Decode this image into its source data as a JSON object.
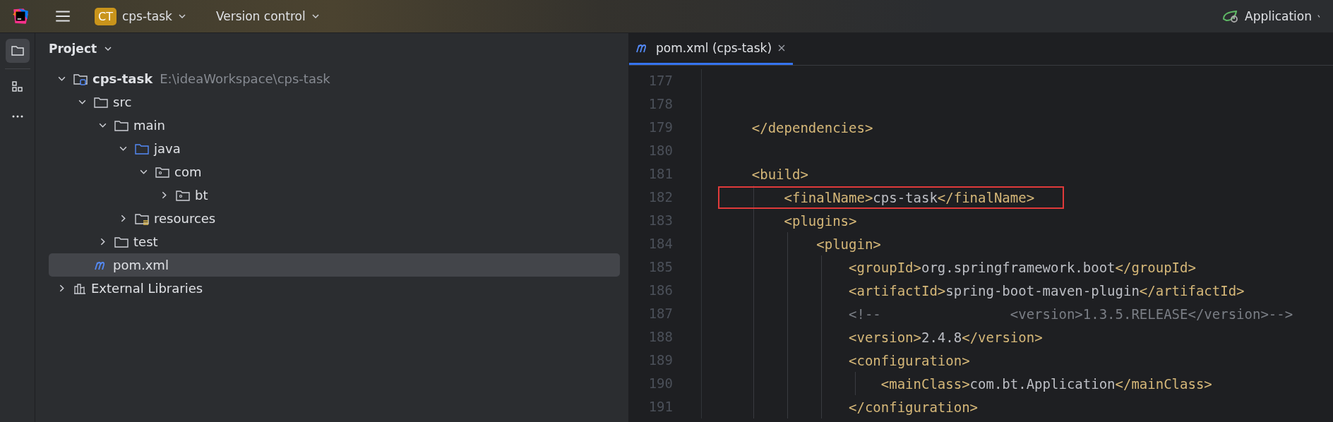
{
  "toolbar": {
    "project_badge": "CT",
    "project": "cps-task",
    "vcs": "Version control",
    "run_config": "Application"
  },
  "tool_stripe": [
    {
      "kind": "project",
      "selected": true
    },
    {
      "kind": "structure",
      "selected": false
    },
    {
      "kind": "more",
      "selected": false
    }
  ],
  "project_panel": {
    "title": "Project",
    "tree": [
      {
        "label": "cps-task",
        "hint": "E:\\ideaWorkspace\\cps-task",
        "kind": "module",
        "expanded": true,
        "selected": false,
        "children": [
          {
            "label": "src",
            "kind": "folder",
            "expanded": true,
            "selected": false,
            "children": [
              {
                "label": "main",
                "kind": "folder",
                "expanded": true,
                "selected": false,
                "children": [
                  {
                    "label": "java",
                    "kind": "source",
                    "expanded": true,
                    "selected": false,
                    "children": [
                      {
                        "label": "com",
                        "kind": "package",
                        "expanded": true,
                        "selected": false,
                        "children": [
                          {
                            "label": "bt",
                            "kind": "package",
                            "expanded": false,
                            "selected": false
                          }
                        ]
                      }
                    ]
                  },
                  {
                    "label": "resources",
                    "kind": "resources",
                    "expanded": false,
                    "selected": false
                  }
                ]
              },
              {
                "label": "test",
                "kind": "folder",
                "expanded": false,
                "selected": false
              }
            ]
          },
          {
            "label": "pom.xml",
            "kind": "maven",
            "selected": true
          }
        ]
      },
      {
        "label": "External Libraries",
        "kind": "library",
        "expanded": false,
        "selected": false
      }
    ]
  },
  "editor": {
    "tabs": [
      {
        "label": "pom.xml (cps-task)",
        "selected": true
      }
    ],
    "lines": [
      {
        "number": "177"
      },
      {
        "number": "178"
      },
      {
        "number": "179",
        "highlighted": false,
        "tokens": [
          {
            "kind": "tag",
            "text": "    </dependencies>"
          }
        ]
      },
      {
        "number": "180"
      },
      {
        "number": "181",
        "highlighted": false,
        "tokens": [
          {
            "kind": "tag",
            "text": "    <build>"
          }
        ]
      },
      {
        "number": "182",
        "highlighted": true,
        "tokens": [
          {
            "kind": "tag",
            "text": "        <finalName>"
          },
          {
            "kind": "text",
            "text": "cps-task"
          },
          {
            "kind": "tag",
            "text": "</finalName>"
          }
        ]
      },
      {
        "number": "183",
        "highlighted": false,
        "tokens": [
          {
            "kind": "tag",
            "text": "        <plugins>"
          }
        ]
      },
      {
        "number": "184",
        "highlighted": false,
        "tokens": [
          {
            "kind": "tag",
            "text": "            <plugin>"
          }
        ]
      },
      {
        "number": "185",
        "highlighted": false,
        "tokens": [
          {
            "kind": "tag",
            "text": "                <groupId>"
          },
          {
            "kind": "text",
            "text": "org.springframework.boot"
          },
          {
            "kind": "tag",
            "text": "</groupId>"
          }
        ]
      },
      {
        "number": "186",
        "highlighted": false,
        "tokens": [
          {
            "kind": "tag",
            "text": "                <artifactId>"
          },
          {
            "kind": "text",
            "text": "spring-boot-maven-plugin"
          },
          {
            "kind": "tag",
            "text": "</artifactId>"
          }
        ]
      },
      {
        "number": "187",
        "highlighted": false,
        "tokens": [
          {
            "kind": "comment",
            "text": "                <!--                <version>1.3.5.RELEASE</version>-->"
          }
        ]
      },
      {
        "number": "188",
        "highlighted": false,
        "tokens": [
          {
            "kind": "tag",
            "text": "                <version>"
          },
          {
            "kind": "text",
            "text": "2.4.8"
          },
          {
            "kind": "tag",
            "text": "</version>"
          }
        ]
      },
      {
        "number": "189",
        "highlighted": false,
        "tokens": [
          {
            "kind": "tag",
            "text": "                <configuration>"
          }
        ]
      },
      {
        "number": "190",
        "highlighted": false,
        "tokens": [
          {
            "kind": "tag",
            "text": "                    <mainClass>"
          },
          {
            "kind": "text",
            "text": "com.bt.Application"
          },
          {
            "kind": "tag",
            "text": "</mainClass>"
          }
        ]
      },
      {
        "number": "191",
        "highlighted": false,
        "tokens": [
          {
            "kind": "tag",
            "text": "                </configuration>"
          }
        ]
      }
    ]
  }
}
